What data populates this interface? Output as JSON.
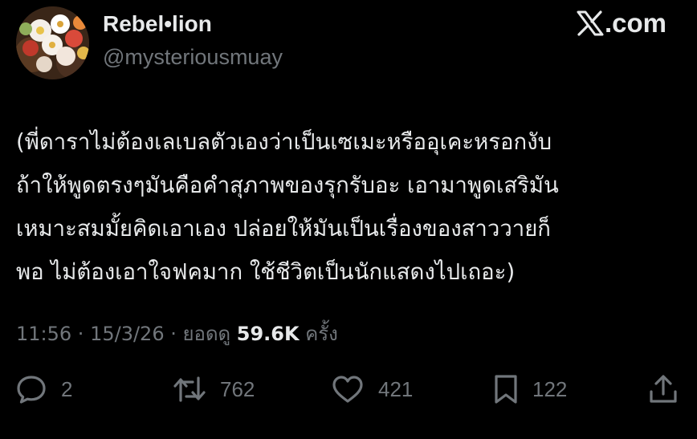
{
  "header": {
    "display_name": "Rebel•lion",
    "handle": "@mysteriousmuay",
    "brand": "X.com",
    "brand_icon": "x-logo-icon",
    "avatar": "flower-bouquet-avatar"
  },
  "tweet": {
    "lines": [
      "(พี่ดาราไม่ต้องเลเบลตัวเองว่าเป็นเซเมะหรืออุเคะหรอกงับ",
      "ถ้าให้พูดตรงๆมันคือคำสุภาพของรุกรับอะ เอามาพูดเสริมัน",
      "เหมาะสมมั้ยคิดเอาเอง ปล่อยให้มันเป็นเรื่องของสาววายก็",
      "พอ ไม่ต้องเอาใจฟคมาก ใช้ชีวิตเป็นนักแสดงไปเถอะ)"
    ]
  },
  "meta": {
    "time": "11:56",
    "sep1": " · ",
    "date": "15/3/26",
    "sep2": " · ",
    "views_label": "ยอดดู ",
    "views_count": "59.6K",
    "views_suffix": " ครั้ง"
  },
  "actions": {
    "reply": {
      "icon": "reply-icon",
      "count": "2"
    },
    "retweet": {
      "icon": "retweet-icon",
      "count": "762"
    },
    "like": {
      "icon": "heart-icon",
      "count": "421"
    },
    "bookmark": {
      "icon": "bookmark-icon",
      "count": "122"
    },
    "share": {
      "icon": "share-icon"
    }
  },
  "colors": {
    "background": "#000000",
    "primary_text": "#e7e9ea",
    "secondary_text": "#71767b"
  }
}
